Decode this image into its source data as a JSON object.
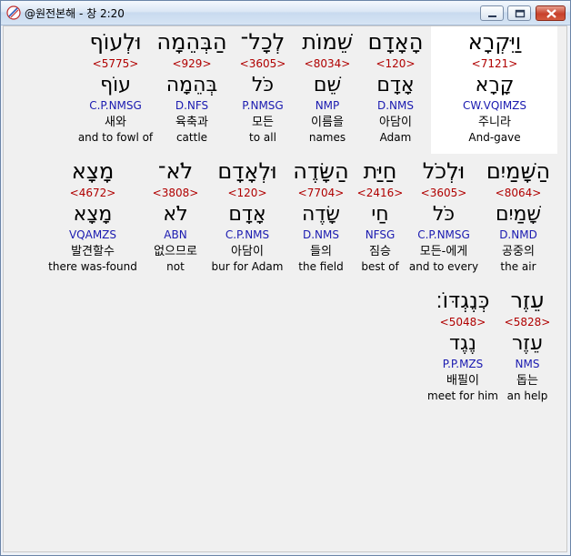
{
  "window": {
    "title": "@원전본해 - 창 2:20"
  },
  "rows": [
    [
      {
        "heb": "וַיִּקְרָא",
        "strong": "<7121>",
        "lex": "קָרָא",
        "morph": "CW.VQIMZS",
        "kor": "주니라",
        "eng": "And-gave"
      },
      {
        "heb": "הָאָדָם",
        "strong": "<120>",
        "lex": "אָדָם",
        "morph": "D.NMS",
        "kor": "아담이",
        "eng": "Adam"
      },
      {
        "heb": "שֵׁמוֹת",
        "strong": "<8034>",
        "lex": "שֵׁם",
        "morph": "NMP",
        "kor": "이름을",
        "eng": "names"
      },
      {
        "heb": "לְכָל־",
        "strong": "<3605>",
        "lex": "כֹּל",
        "morph": "P.NMSG",
        "kor": "모든",
        "eng": "to all"
      },
      {
        "heb": "הַבְּהֵמָה",
        "strong": "<929>",
        "lex": "בְּהֵמָה",
        "morph": "D.NFS",
        "kor": "육축과",
        "eng": "cattle"
      },
      {
        "heb": "וּלְעוֹף",
        "strong": "<5775>",
        "lex": "עוֹף",
        "morph": "C.P.NMSG",
        "kor": "새와",
        "eng": "and to fowl of"
      }
    ],
    [
      {
        "heb": "הַשָּׁמַיִם",
        "strong": "<8064>",
        "lex": "שָׁמַיִם",
        "morph": "D.NMD",
        "kor": "공중의",
        "eng": "the air"
      },
      {
        "heb": "וּלְכֹל",
        "strong": "<3605>",
        "lex": "כֹּל",
        "morph": "C.P.NMSG",
        "kor": "모든-에게",
        "eng": "and to every"
      },
      {
        "heb": "חַיַּת",
        "strong": "<2416>",
        "lex": "חַי",
        "morph": "NFSG",
        "kor": "짐승",
        "eng": "best of"
      },
      {
        "heb": "הַשָּׂדֶה",
        "strong": "<7704>",
        "lex": "שָׂדֶה",
        "morph": "D.NMS",
        "kor": "들의",
        "eng": "the field"
      },
      {
        "heb": "וּלְאָדָם",
        "strong": "<120>",
        "lex": "אָדָם",
        "morph": "C.P.NMS",
        "kor": "아담이",
        "eng": "bur for Adam"
      },
      {
        "heb": "לֹא־",
        "strong": "<3808>",
        "lex": "לֹא",
        "morph": "ABN",
        "kor": "없으므로",
        "eng": "not"
      },
      {
        "heb": "מָצָא",
        "strong": "<4672>",
        "lex": "מָצָא",
        "morph": "VQAMZS",
        "kor": "발견할수",
        "eng": "there was-found"
      }
    ],
    [
      {
        "heb": "עֵזֶר",
        "strong": "<5828>",
        "lex": "עֵזֶר",
        "morph": "NMS",
        "kor": "돕는",
        "eng": "an help"
      },
      {
        "heb": "כְּנֶגְדּוֹ׃",
        "strong": "<5048>",
        "lex": "נֶגֶד",
        "morph": "P.P.MZS",
        "kor": "배필이",
        "eng": "meet for him"
      }
    ]
  ],
  "colors": {
    "hebrew": "#000000",
    "strong": "#b00000",
    "morph": "#1a1ab0",
    "selected_bg": "#ffffff"
  }
}
